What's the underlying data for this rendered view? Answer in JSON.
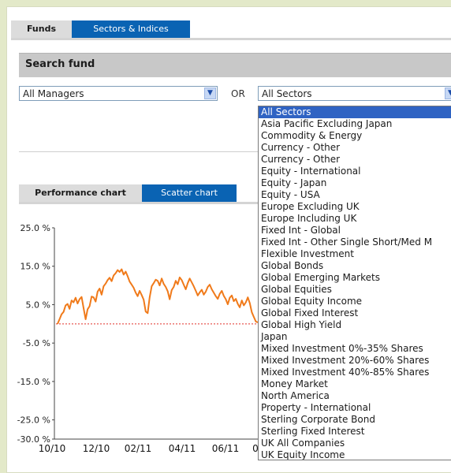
{
  "tabs": [
    {
      "label": "Funds",
      "active": true
    },
    {
      "label": "Sectors & Indices",
      "active": false
    }
  ],
  "search": {
    "title": "Search fund",
    "manager_select": "All Managers",
    "or_label": "OR",
    "sector_select": "All Sectors"
  },
  "sector_options": [
    "All Sectors",
    "Asia Pacific Excluding Japan",
    "Commodity & Energy",
    "Currency - Other",
    "Currency - Other",
    "Equity - International",
    "Equity - Japan",
    "Equity - USA",
    "Europe Excluding UK",
    "Europe Including UK",
    "Fixed Int - Global",
    "Fixed Int - Other Single Short/Med M",
    "Flexible Investment",
    "Global Bonds",
    "Global Emerging Markets",
    "Global Equities",
    "Global Equity Income",
    "Global Fixed Interest",
    "Global High Yield",
    "Japan",
    "Mixed Investment 0%-35% Shares",
    "Mixed Investment 20%-60% Shares",
    "Mixed Investment 40%-85% Shares",
    "Money Market",
    "North America",
    "Property - International",
    "Sterling Corporate Bond",
    "Sterling Fixed Interest",
    "UK All Companies",
    "UK Equity Income"
  ],
  "chart_tabs": [
    {
      "label": "Performance chart",
      "active": true
    },
    {
      "label": "Scatter chart",
      "active": false
    }
  ],
  "colors": {
    "tab_blue": "#0a63b3",
    "line_orange": "#f07a1a",
    "baseline_red": "#e0302a",
    "selected_option": "#2f63c3"
  },
  "chart_data": {
    "type": "line",
    "title": "",
    "xlabel": "",
    "ylabel": "",
    "ylim": [
      -30,
      25
    ],
    "y_ticks": [
      25,
      15,
      5,
      -5,
      -15,
      -25,
      -30
    ],
    "y_tick_labels": [
      "25.0 %",
      "15.0 %",
      "5.0 %",
      "-5.0 %",
      "-15.0 %",
      "-25.0 %",
      "-30.0 %"
    ],
    "x_tick_labels": [
      "10/10",
      "12/10",
      "02/11",
      "04/11",
      "06/11",
      "0"
    ],
    "baseline": 0,
    "series": [
      {
        "x": [
          0,
          1,
          2,
          3,
          4,
          5,
          6,
          7,
          8,
          9,
          10,
          11,
          12,
          13,
          14,
          15,
          16,
          17,
          18,
          19,
          20,
          21,
          22,
          23,
          24,
          25,
          26,
          27,
          28,
          29,
          30,
          31,
          32,
          33,
          34,
          35,
          36,
          37,
          38,
          39,
          40,
          41,
          42,
          43,
          44,
          45,
          46,
          47,
          48,
          49,
          50,
          51,
          52,
          53,
          54,
          55,
          56,
          57,
          58,
          59,
          60,
          61,
          62,
          63,
          64,
          65,
          66,
          67,
          68,
          69,
          70,
          71,
          72,
          73,
          74,
          75,
          76,
          77,
          78,
          79,
          80,
          81,
          82,
          83,
          84,
          85,
          86,
          87,
          88,
          89,
          90,
          91,
          92,
          93,
          94,
          95,
          96,
          97,
          98,
          99,
          100
        ],
        "values": [
          0,
          1.2,
          2.5,
          3.1,
          4.8,
          5.2,
          3.9,
          6.1,
          5.6,
          6.8,
          5.3,
          6.4,
          7.0,
          4.1,
          1.2,
          3.8,
          4.6,
          7.1,
          6.9,
          5.8,
          8.4,
          9.2,
          7.6,
          9.8,
          10.5,
          11.4,
          12.0,
          11.1,
          12.6,
          13.2,
          14.0,
          13.5,
          14.2,
          12.8,
          13.6,
          12.4,
          11.0,
          10.2,
          9.4,
          8.1,
          7.2,
          8.6,
          7.5,
          6.3,
          3.2,
          2.8,
          6.9,
          9.8,
          10.6,
          11.5,
          11.2,
          10.0,
          11.8,
          10.4,
          9.6,
          8.5,
          6.4,
          8.8,
          9.6,
          11.2,
          10.3,
          12.1,
          11.4,
          10.2,
          9.0,
          10.6,
          11.8,
          10.8,
          9.8,
          8.6,
          7.4,
          8.2,
          8.9,
          7.6,
          8.4,
          9.6,
          10.2,
          9.0,
          8.1,
          7.2,
          6.5,
          7.8,
          8.6,
          7.3,
          6.4,
          5.1,
          6.8,
          7.4,
          5.9,
          6.5,
          5.2,
          4.3,
          6.1,
          4.8,
          5.6,
          6.9,
          5.4,
          3.0,
          1.8,
          0.6,
          0.4
        ]
      }
    ]
  }
}
